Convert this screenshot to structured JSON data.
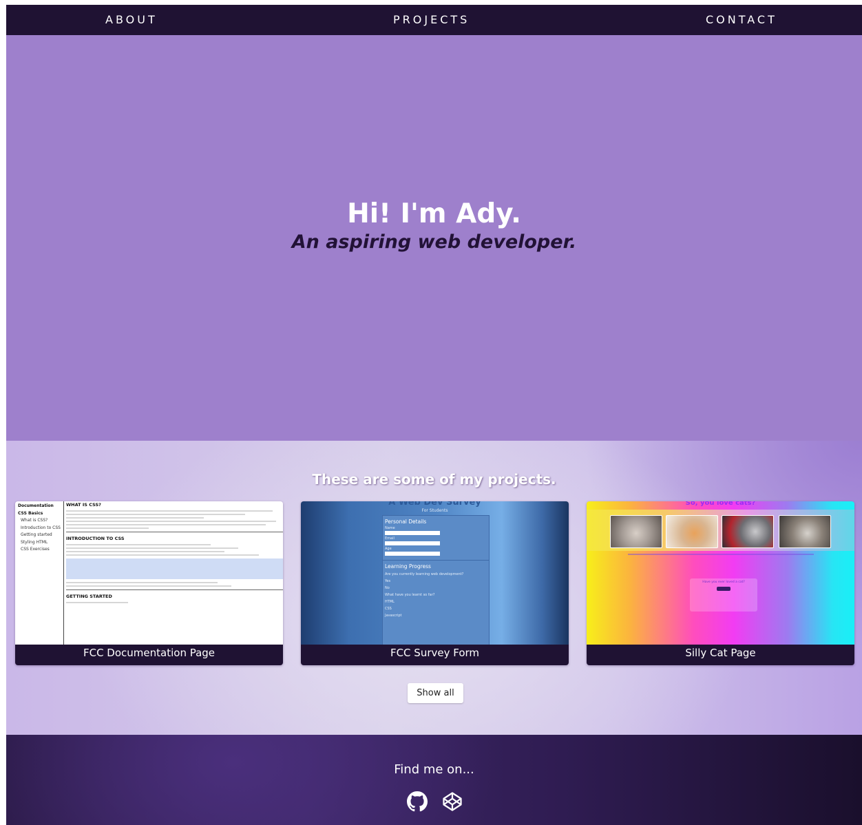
{
  "nav": {
    "about": "ABOUT",
    "projects": "PROJECTS",
    "contact": "CONTACT"
  },
  "hero": {
    "title": "Hi! I'm Ady.",
    "subtitle": "An aspiring web developer."
  },
  "projects": {
    "heading": "These are some of my projects.",
    "cards": [
      {
        "caption": "FCC Documentation Page",
        "thumb": {
          "sidebar_title": "Documentation",
          "sidebar_group": "CSS Basics",
          "sidebar_items": [
            "What is CSS?",
            "Introduction to CSS",
            "Getting started",
            "Styling HTML",
            "CSS Exercises"
          ],
          "sections": [
            "WHAT IS CSS?",
            "INTRODUCTION TO CSS",
            "GETTING STARTED"
          ]
        }
      },
      {
        "caption": "FCC Survey Form",
        "thumb": {
          "title": "A Web Dev Survey",
          "subtitle": "For Students",
          "section_1": "Personal Details",
          "fields": [
            "Name",
            "Email",
            "Age"
          ],
          "section_2": "Learning Progress",
          "question": "Are you currently learning web development?",
          "options": [
            "Yes",
            "No"
          ],
          "question_2": "What have you learnt so far?",
          "learnt": [
            "HTML",
            "CSS",
            "Javascript"
          ]
        }
      },
      {
        "caption": "Silly Cat Page",
        "thumb": {
          "title": "So, you love cats?",
          "form_title": "Have you ever loved a cat?"
        }
      }
    ],
    "show_all": "Show all"
  },
  "footer": {
    "title": "Find me on...",
    "icons": [
      "github-icon",
      "codepen-icon"
    ]
  },
  "colors": {
    "nav_bg": "#1f1233",
    "hero_bg": "#9e80cc",
    "footer_bg": "#2c1b49"
  }
}
